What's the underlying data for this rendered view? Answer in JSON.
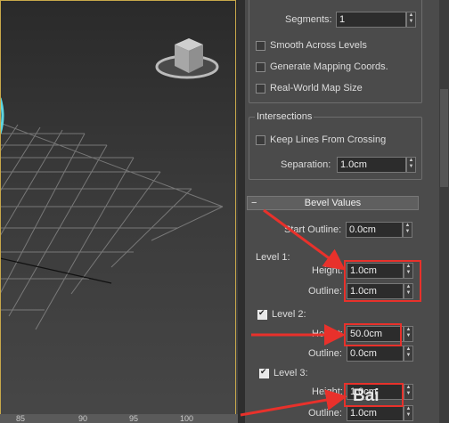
{
  "ruler": {
    "ticks": [
      "85",
      "90",
      "95",
      "100"
    ]
  },
  "top_group": {
    "segments": {
      "label": "Segments:",
      "value": "1"
    },
    "smooth_across_levels": {
      "label": "Smooth Across Levels",
      "checked": false
    },
    "generate_mapping": {
      "label": "Generate Mapping Coords.",
      "checked": false
    },
    "real_world_map": {
      "label": "Real-World Map Size",
      "checked": false
    }
  },
  "intersections": {
    "title": "Intersections",
    "keep_lines": {
      "label": "Keep Lines From Crossing",
      "checked": false
    },
    "separation": {
      "label": "Separation:",
      "value": "1.0cm"
    }
  },
  "bevel_values": {
    "collapse_symbol": "−",
    "title": "Bevel Values",
    "start_outline": {
      "label": "Start Outline:",
      "value": "0.0cm"
    },
    "level1": {
      "label": "Level 1:",
      "height_label": "Height:",
      "height": "1.0cm",
      "outline_label": "Outline:",
      "outline": "1.0cm"
    },
    "level2": {
      "label": "Level 2:",
      "checked": true,
      "height_label": "Height:",
      "height": "50.0cm",
      "outline_label": "Outline:",
      "outline": "0.0cm"
    },
    "level3": {
      "label": "Level 3:",
      "checked": true,
      "height_label": "Height:",
      "height": "1.0cm",
      "outline_label": "Outline:",
      "outline": "1.0cm"
    }
  },
  "watermark": "Bai",
  "colors": {
    "annotation": "#e8312b",
    "viewport_frame": "#c8a84a",
    "panel": "#4b4b4b"
  }
}
